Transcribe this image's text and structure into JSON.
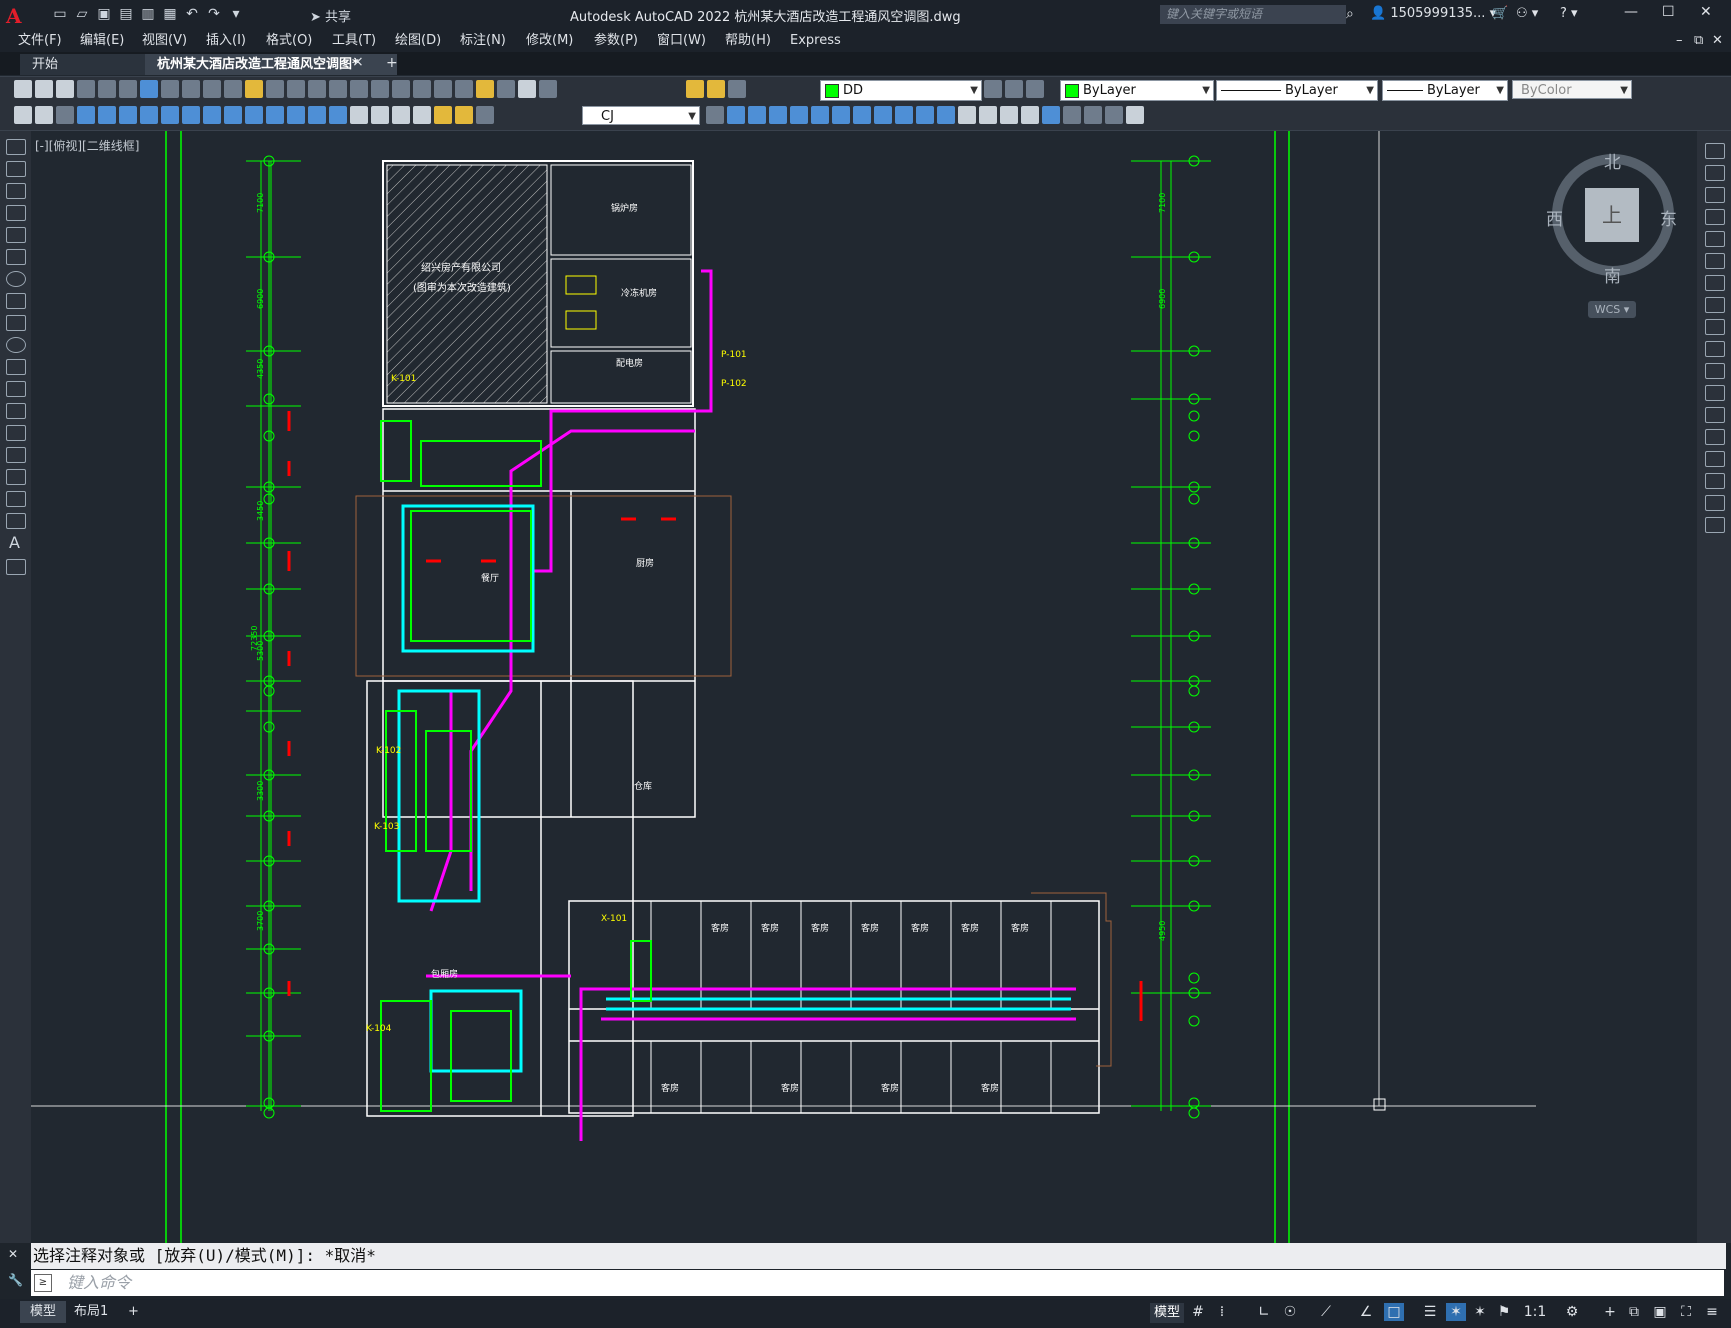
{
  "app": {
    "logo": "A",
    "title": "Autodesk AutoCAD 2022    杭州某大酒店改造工程通风空调图.dwg",
    "share_label": "共享",
    "search_placeholder": "键入关键字或短语",
    "user": "1505999135...",
    "help": "?"
  },
  "menu": [
    "文件(F)",
    "编辑(E)",
    "视图(V)",
    "插入(I)",
    "格式(O)",
    "工具(T)",
    "绘图(D)",
    "标注(N)",
    "修改(M)",
    "参数(P)",
    "窗口(W)",
    "帮助(H)",
    "Express"
  ],
  "tabs": {
    "start": "开始",
    "document": "杭州某大酒店改造工程通风空调图*",
    "close": "×",
    "add": "+"
  },
  "toolbar": {
    "layer_value": "DD",
    "color_value": "ByLayer",
    "linetype_value": "ByLayer",
    "lineweight_value": "ByLayer",
    "plotstyle_value": "ByColor",
    "textstyle_value": "CJ"
  },
  "viewport": {
    "label": "[-][俯视][二维线框]"
  },
  "viewcube": {
    "north": "北",
    "south": "南",
    "east": "东",
    "west": "西",
    "top": "上",
    "wcs": "WCS"
  },
  "drawing": {
    "building_label_1": "绍兴房产有限公司",
    "building_label_2": "(图审为本次改造建筑)",
    "rooms": [
      "锅炉房",
      "冷冻机房",
      "配电房",
      "餐厅",
      "厨房",
      "仓库",
      "客房",
      "包厢房"
    ],
    "tags": [
      "K-101",
      "K-102",
      "K-103",
      "K-104",
      "P-101",
      "P-102",
      "X-101"
    ],
    "dims": [
      "7100",
      "6900",
      "4350",
      "3450",
      "5300",
      "3300",
      "3700",
      "72350",
      "4950"
    ]
  },
  "command": {
    "history": "选择注释对象或 [放弃(U)/模式(M)]: *取消*",
    "placeholder": "键入命令"
  },
  "status": {
    "tab_model": "模型",
    "tab_layout": "布局1",
    "tab_add": "+",
    "model_btn": "模型",
    "scale": "1:1"
  },
  "colors": {
    "canvas": "#212830",
    "accent": "#2f6fb0",
    "green": "#00ff00",
    "magenta": "#ff00ff",
    "cyan": "#00ffff",
    "red": "#ff0000",
    "yellow": "#ffff00",
    "white": "#ffffff"
  }
}
